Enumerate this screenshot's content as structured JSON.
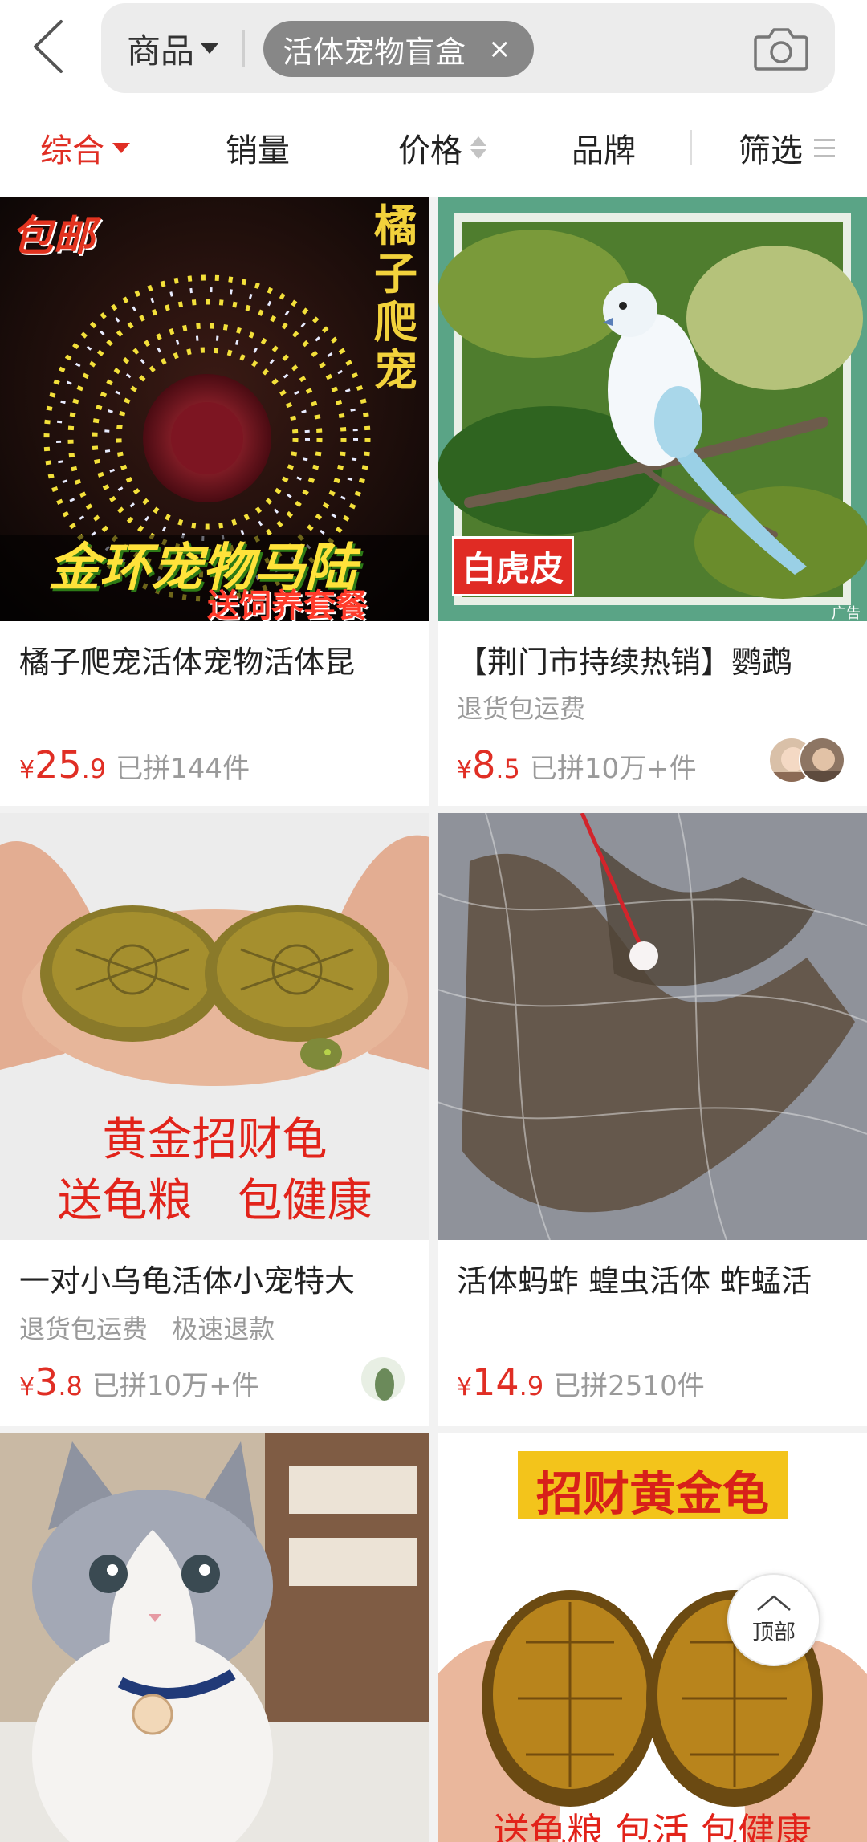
{
  "header": {
    "scope_label": "商品",
    "query": "活体宠物盲盒",
    "clear_glyph": "×",
    "icons": [
      "back-icon",
      "chevron-down-icon",
      "close-icon",
      "camera-icon"
    ]
  },
  "sort_bar": {
    "items": [
      "综合",
      "销量",
      "价格",
      "品牌",
      "筛选"
    ],
    "active": "综合",
    "active_color": "#e02e24"
  },
  "products": [
    {
      "overlay": {
        "badge": "包邮",
        "brand_vertical": "橘子爬宠",
        "headline": "金环宠物马陆",
        "subline": "送饲养套餐"
      },
      "title": "橘子爬宠活体宠物活体昆",
      "tags": [],
      "price_currency": "¥",
      "price_int": "25",
      "price_dec": ".9",
      "sold": "已拼144件"
    },
    {
      "overlay": {
        "label": "白虎皮",
        "ad_mark": "广告"
      },
      "title": "【荆门市持续热销】鹦鹉",
      "tags": [
        "退货包运费"
      ],
      "price_currency": "¥",
      "price_int": "8",
      "price_dec": ".5",
      "sold": "已拼10万+件"
    },
    {
      "overlay": {
        "line1": "黄金招财龟",
        "line2": "送龟粮　包健康"
      },
      "title": "一对小乌龟活体小宠特大",
      "tags": [
        "退货包运费",
        "极速退款"
      ],
      "price_currency": "¥",
      "price_int": "3",
      "price_dec": ".8",
      "sold": "已拼10万+件"
    },
    {
      "overlay": {},
      "title": "活体蚂蚱 蝗虫活体 蚱蜢活",
      "tags": [],
      "price_currency": "¥",
      "price_int": "14",
      "price_dec": ".9",
      "sold": "已拼2510件"
    },
    {
      "overlay": {},
      "title": "",
      "tags": [],
      "price_currency": "",
      "price_int": "",
      "price_dec": "",
      "sold": ""
    },
    {
      "overlay": {
        "banner": "招财黄金龟",
        "footer": "送龟粮 包活 包健康"
      },
      "title": "",
      "tags": [],
      "price_currency": "",
      "price_int": "",
      "price_dec": "",
      "sold": ""
    }
  ],
  "back_to_top": {
    "label": "顶部"
  }
}
